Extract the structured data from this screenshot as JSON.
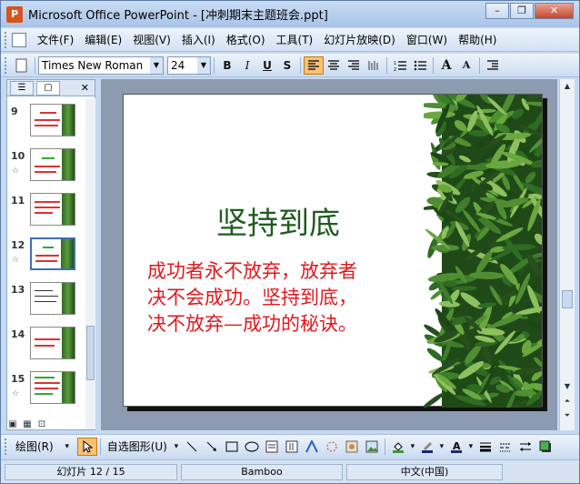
{
  "window": {
    "title": "Microsoft Office PowerPoint - [冲刺期末主题班会.ppt]",
    "minimize": "–",
    "restore": "❐",
    "close": "✕"
  },
  "menu": {
    "items": [
      "文件(F)",
      "编辑(E)",
      "视图(V)",
      "插入(I)",
      "格式(O)",
      "工具(T)",
      "幻灯片放映(D)",
      "窗口(W)",
      "帮助(H)"
    ]
  },
  "toolbar": {
    "font": "Times New Roman",
    "size": "24",
    "bold": "B",
    "italic": "I",
    "underline": "U",
    "shadow": "S",
    "grow_font": "A",
    "shrink_font": "A"
  },
  "panel": {
    "close": "✕",
    "slides": [
      {
        "num": "9",
        "star": false
      },
      {
        "num": "10",
        "star": true
      },
      {
        "num": "11",
        "star": false
      },
      {
        "num": "12",
        "star": true,
        "selected": true
      },
      {
        "num": "13",
        "star": false
      },
      {
        "num": "14",
        "star": false
      },
      {
        "num": "15",
        "star": true
      }
    ]
  },
  "slide": {
    "title": "坚持到底",
    "body": [
      "成功者永不放弃，放弃者",
      "决不会成功。坚持到底，",
      "决不放弃—成功的秘诀。"
    ]
  },
  "drawbar": {
    "draw": "绘图(R)",
    "autoshapes": "自选图形(U)"
  },
  "status": {
    "slide": "幻灯片 12 / 15",
    "design": "Bamboo",
    "language": "中文(中国)"
  },
  "colors": {
    "title_green": "#1e5b1e",
    "body_red": "#e0191e"
  }
}
